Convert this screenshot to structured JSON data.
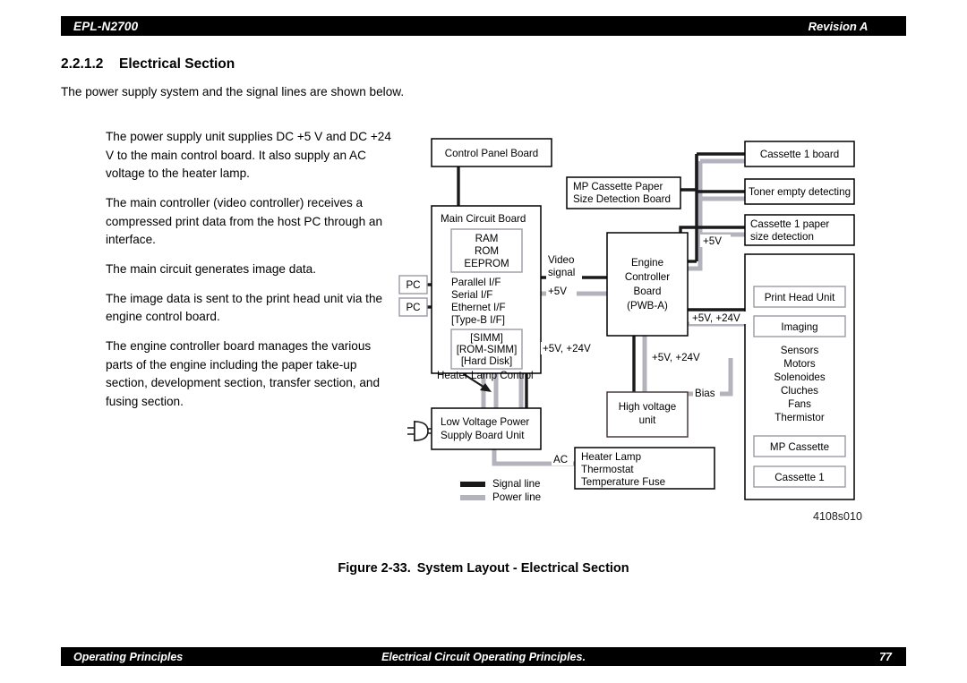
{
  "header": {
    "model": "EPL-N2700",
    "revision": "Revision A"
  },
  "section": {
    "number": "2.2.1.2",
    "title": "Electrical Section",
    "lead": "The power supply system and the signal lines are shown below."
  },
  "body_paragraphs": [
    "The power supply unit supplies DC +5 V and DC +24 V to the main control board. It also supply an AC voltage to the heater lamp.",
    "The main controller (video controller) receives a compressed print data from the host PC through an interface.",
    "The main circuit generates image data.",
    "The image data is sent to the print head unit via the engine control board.",
    "The engine controller board manages the various parts of the engine including the paper take-up section, development section, transfer section, and fusing section."
  ],
  "figure": {
    "id": "4108s010",
    "caption_number": "Figure 2-33.",
    "caption_title": "System Layout - Electrical Section"
  },
  "footer": {
    "left": "Operating Principles",
    "center": "Electrical Circuit Operating Principles.",
    "page": "77"
  },
  "colors": {
    "signal_line": "#1a1a1a",
    "power_line": "#b3b3bd",
    "box_border": "#000000",
    "inner_box_border": "#9a9aa2",
    "header_bar": "#000000"
  },
  "diagram": {
    "boxes": {
      "control_panel": "Control Panel Board",
      "main_circuit": "Main Circuit Board",
      "memory": [
        "RAM",
        "ROM",
        "EEPROM"
      ],
      "interfaces": [
        "Parallel I/F",
        "Serial I/F",
        "Ethernet I/F",
        "[Type-B I/F]"
      ],
      "options": [
        "[SIMM]",
        "[ROM-SIMM]",
        "[Hard Disk]"
      ],
      "pc_1": "PC",
      "pc_2": "PC",
      "mp_cassette_paper": [
        "MP Cassette Paper",
        "Size Detection Board"
      ],
      "engine_controller": [
        "Engine",
        "Controller",
        "Board",
        "(PWB-A)"
      ],
      "cassette1_board": "Cassette 1 board",
      "toner_empty": "Toner empty detecting",
      "cassette1_paper": [
        "Cassette 1 paper",
        "size detection"
      ],
      "print_head_unit": "Print Head Unit",
      "imaging": "Imaging",
      "engine_parts": [
        "Sensors",
        "Motors",
        "Solenoides",
        "Cluches",
        "Fans",
        "Thermistor"
      ],
      "mp_cassette": "MP Cassette",
      "cassette_1": "Cassette 1",
      "high_voltage": [
        "High voltage",
        "unit"
      ],
      "low_voltage": [
        "Low Voltage Power",
        "Supply Board Unit"
      ],
      "heater_lamp": [
        "Heater Lamp",
        "Thermostat",
        "Temperature Fuse"
      ]
    },
    "labels": {
      "video_signal": [
        "Video",
        "signal"
      ],
      "plus5v_video": "+5V",
      "plus5v_right": "+5V",
      "plus5v24v_right": "+5V, +24V",
      "plus5v24v_left": "+5V, +24V",
      "plus5v24v_mid": "+5V, +24V",
      "bias": "Bias",
      "ac": "AC",
      "heater_lamp_control": "Heater Lamp Control"
    },
    "legend": [
      {
        "label": "Signal line",
        "color": "#1a1a1a"
      },
      {
        "label": "Power line",
        "color": "#b3b3bd"
      }
    ]
  }
}
